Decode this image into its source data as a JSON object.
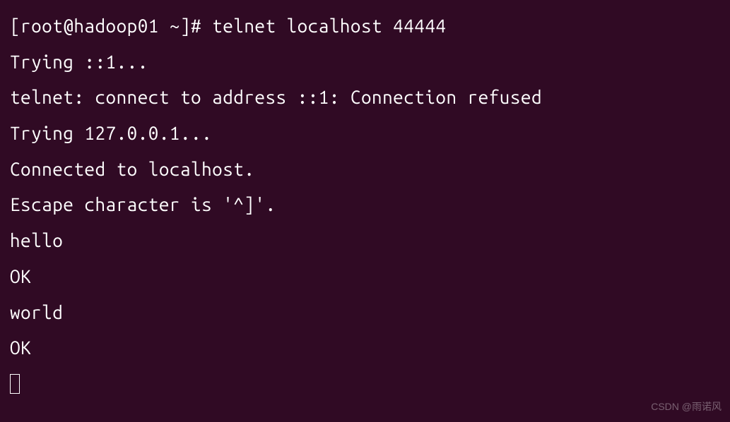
{
  "terminal": {
    "prompt": "[root@hadoop01 ~]# ",
    "command": "telnet localhost 44444",
    "lines": [
      "Trying ::1...",
      "telnet: connect to address ::1: Connection refused",
      "Trying 127.0.0.1...",
      "Connected to localhost.",
      "Escape character is '^]'.",
      "hello",
      "OK",
      "world",
      "OK"
    ]
  },
  "watermark": "CSDN @雨诺风"
}
